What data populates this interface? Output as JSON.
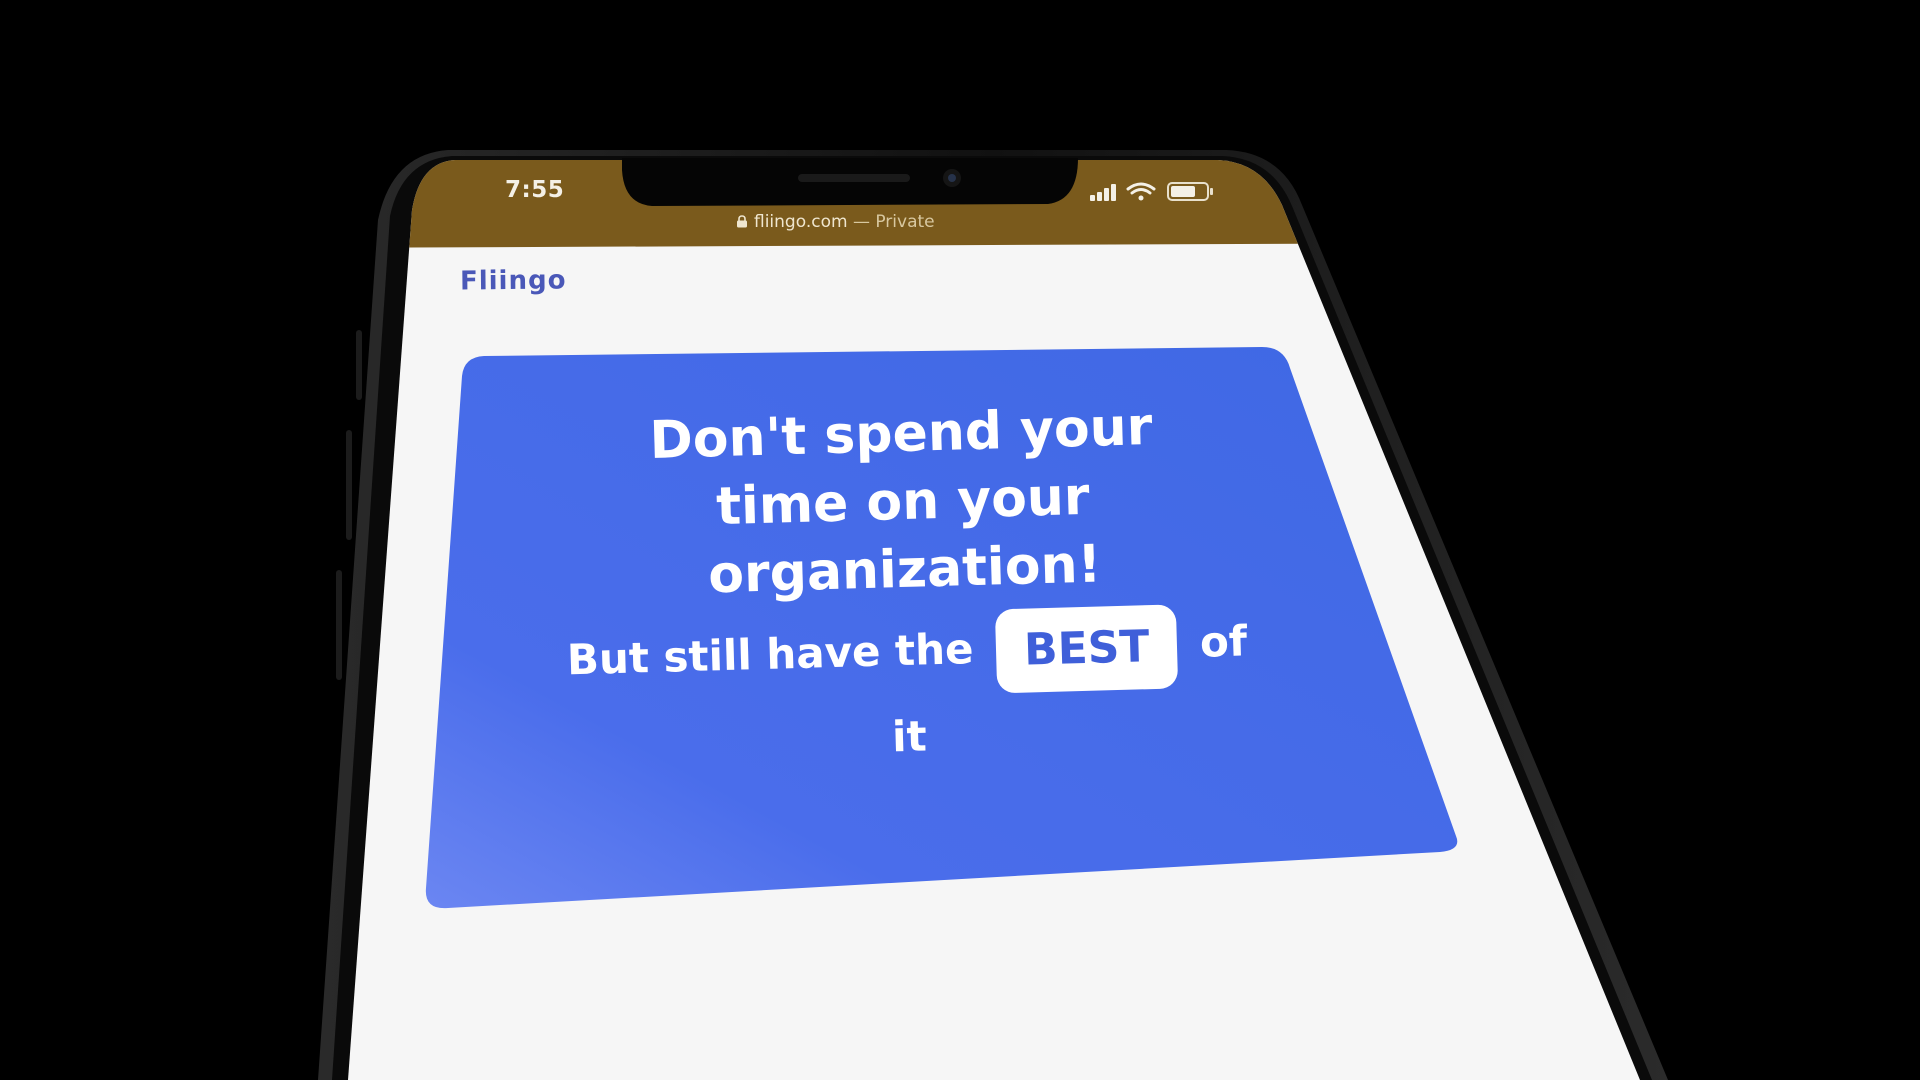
{
  "status_bar": {
    "time": "7:55"
  },
  "browser": {
    "url": "fliingo.com",
    "private_label": "— Private"
  },
  "site": {
    "logo": "Fliingo"
  },
  "hero": {
    "headline": "Don't spend your time on your organization!",
    "sub_prefix": "But still have the",
    "badge": "BEST",
    "sub_suffix_1": "of",
    "sub_suffix_2": "it"
  },
  "icons": {
    "signal": "signal-icon",
    "wifi": "wifi-icon",
    "battery": "battery-icon",
    "lock": "lock-icon"
  },
  "colors": {
    "background": "#000000",
    "status_bar": "#7a5a1c",
    "page_background": "#f6f6f6",
    "hero_card": "#456de6",
    "hero_card_gradient": "#6b86f2",
    "logo": "#4a58b8",
    "badge_text": "#3f5fd9"
  }
}
